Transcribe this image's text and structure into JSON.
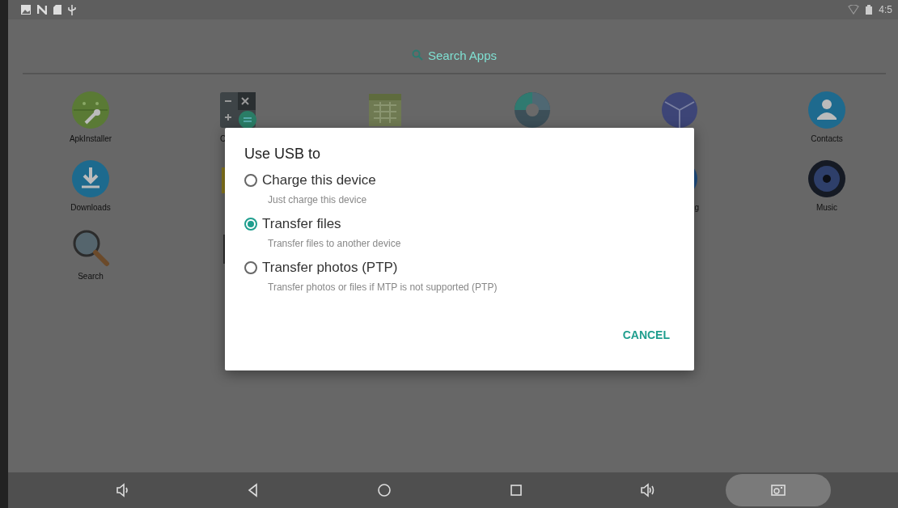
{
  "status_bar": {
    "time": "4:5"
  },
  "search": {
    "placeholder": "Search Apps"
  },
  "apps": [
    [
      {
        "kind": "installer",
        "label": "ApkInstaller"
      },
      {
        "kind": "calculator",
        "label": "C",
        "clipped_end": true
      },
      {
        "kind": "calendar"
      },
      {
        "kind": "camera"
      },
      {
        "kind": "cube"
      },
      {
        "kind": "contacts",
        "label": "Contacts"
      }
    ],
    [
      {
        "kind": "downloads",
        "label": "Downloads"
      },
      {
        "kind": "folder"
      },
      {
        "kind": "covered"
      },
      {
        "kind": "covered"
      },
      {
        "kind": "bluecircle",
        "label": "g",
        "clipped_start": true
      },
      {
        "kind": "music",
        "label": "Music"
      }
    ],
    [
      {
        "kind": "search",
        "label": "Search"
      },
      {
        "kind": "puzzle"
      }
    ]
  ],
  "dialog": {
    "title": "Use USB to",
    "options": [
      {
        "label": "Charge this device",
        "description": "Just charge this device",
        "selected": false
      },
      {
        "label": "Transfer files",
        "description": "Transfer files to another device",
        "selected": true
      },
      {
        "label": "Transfer photos (PTP)",
        "description": "Transfer photos or files if MTP is not supported (PTP)",
        "selected": false
      }
    ],
    "button": "CANCEL"
  },
  "nav_bar": [
    {
      "kind": "volume-down",
      "highlighted": false
    },
    {
      "kind": "back",
      "highlighted": false
    },
    {
      "kind": "home",
      "highlighted": false
    },
    {
      "kind": "recents",
      "highlighted": false
    },
    {
      "kind": "volume-up",
      "highlighted": false
    },
    {
      "kind": "screenshot",
      "highlighted": true
    }
  ]
}
